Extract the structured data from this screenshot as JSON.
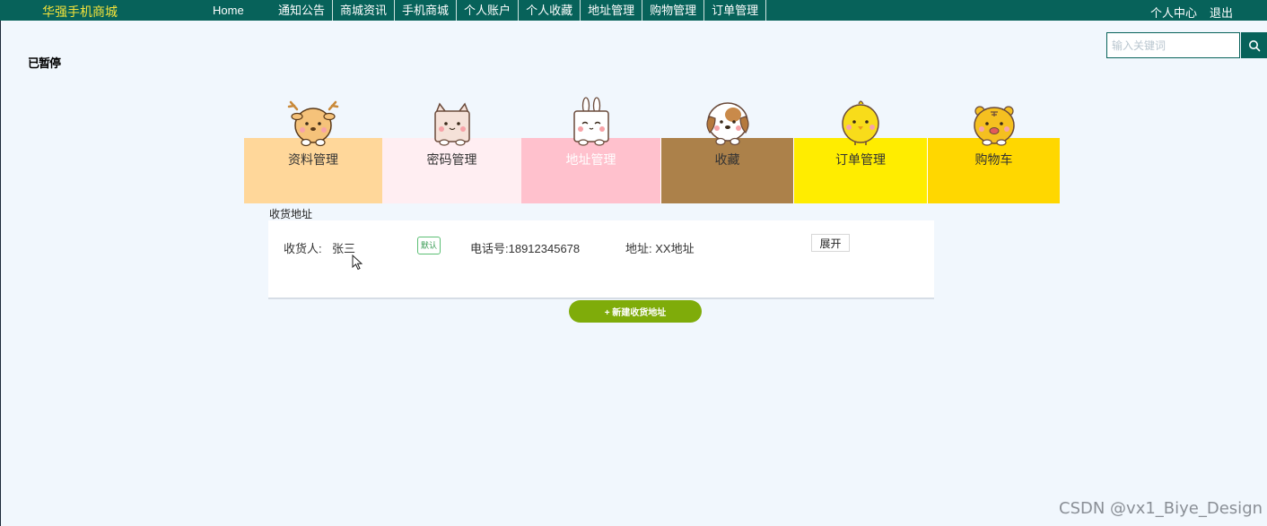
{
  "brand": "华强手机商城",
  "nav": {
    "home": "Home",
    "items": [
      "通知公告",
      "商城资讯",
      "手机商城",
      "个人账户",
      "个人收藏",
      "地址管理",
      "购物管理",
      "订单管理"
    ],
    "user_center": "个人中心",
    "logout": "退出"
  },
  "status_text": "已暂停",
  "search": {
    "placeholder": "输入关键词"
  },
  "tiles": [
    {
      "label": "资料管理",
      "color": "#ffd79a",
      "text_color": "#333333",
      "icon": "deer-icon"
    },
    {
      "label": "密码管理",
      "color": "#ffeef2",
      "text_color": "#333333",
      "icon": "cat-box-icon"
    },
    {
      "label": "地址管理",
      "color": "#ffc1cd",
      "text_color": "#ffffff",
      "icon": "rabbit-box-icon"
    },
    {
      "label": "收藏",
      "color": "#ac814a",
      "text_color": "#333333",
      "icon": "dog-icon"
    },
    {
      "label": "订单管理",
      "color": "#ffed00",
      "text_color": "#333333",
      "icon": "chick-icon"
    },
    {
      "label": "购物车",
      "color": "#ffd700",
      "text_color": "#333333",
      "icon": "tiger-icon"
    }
  ],
  "section_title": "收货地址",
  "address": {
    "receiver_label": "收货人:",
    "receiver_name": "张三",
    "default_badge": "默认",
    "phone": "电话号:18912345678",
    "address": "地址: XX地址",
    "expand_label": "展开"
  },
  "new_address_label": "+ 新建收货地址",
  "watermark": "CSDN @vx1_Biye_Design",
  "colors": {
    "nav_bg": "#07625a",
    "brand": "#f3e23a",
    "page_bg": "#f1f7fd",
    "button_green": "#7fac0a"
  }
}
